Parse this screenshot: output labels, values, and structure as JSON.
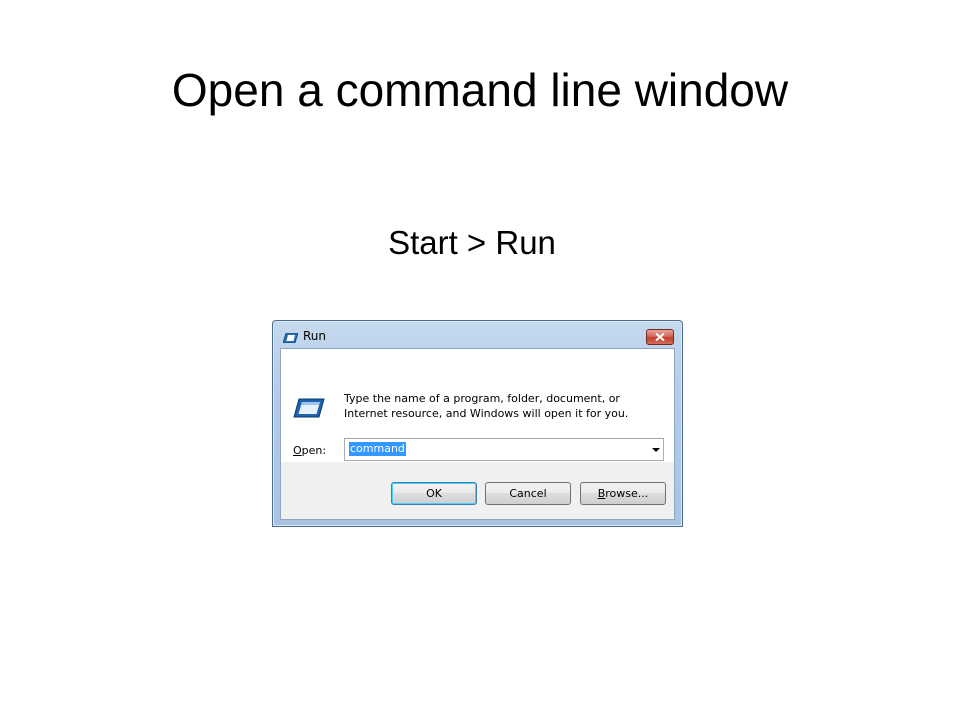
{
  "slide": {
    "title": "Open a command line window",
    "subtitle": "Start > Run"
  },
  "dialog": {
    "title": "Run",
    "title_icon": "run-icon",
    "close_icon": "close-icon",
    "description": "Type the name of a program, folder, document, or Internet resource, and Windows will open it for you.",
    "open_label_accel": "O",
    "open_label_rest": "pen:",
    "open_value": "command",
    "buttons": {
      "ok": "OK",
      "cancel": "Cancel",
      "browse_accel": "B",
      "browse_rest": "rowse..."
    }
  },
  "colors": {
    "selection": "#3399ff",
    "frame": "#b3cbe6",
    "close": "#c3402f"
  }
}
